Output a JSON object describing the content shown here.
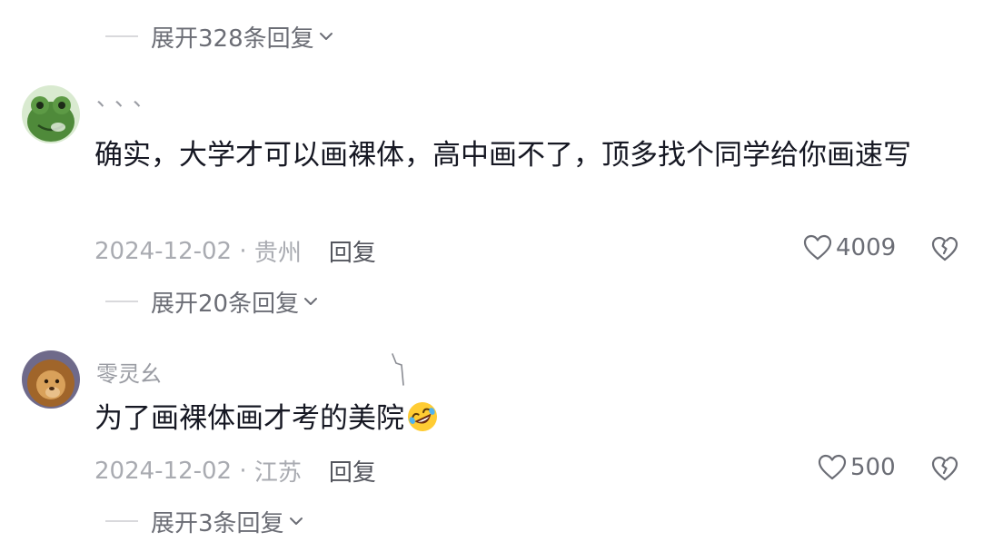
{
  "thread_top": {
    "expand_label": "展开328条回复"
  },
  "comments": [
    {
      "username": "、、、",
      "text": "确实，大学才可以画裸体，高中画不了，顶多找个同学给你画速写",
      "date": "2024-12-02",
      "location": "贵州",
      "reply_label": "回复",
      "likes": "4009",
      "expand_label": "展开20条回复",
      "avatar_icon": "frog-avatar"
    },
    {
      "username": "零灵幺",
      "text": "为了画裸体画才考的美院",
      "emoji": "rolling-on-floor-laughing-emoji",
      "date": "2024-12-02",
      "location": "江苏",
      "reply_label": "回复",
      "likes": "500",
      "expand_label": "展开3条回复",
      "avatar_icon": "lion-avatar"
    }
  ],
  "colors": {
    "text_primary": "#161823",
    "text_secondary": "#a9abb1",
    "expand_text": "#6b6d75"
  }
}
